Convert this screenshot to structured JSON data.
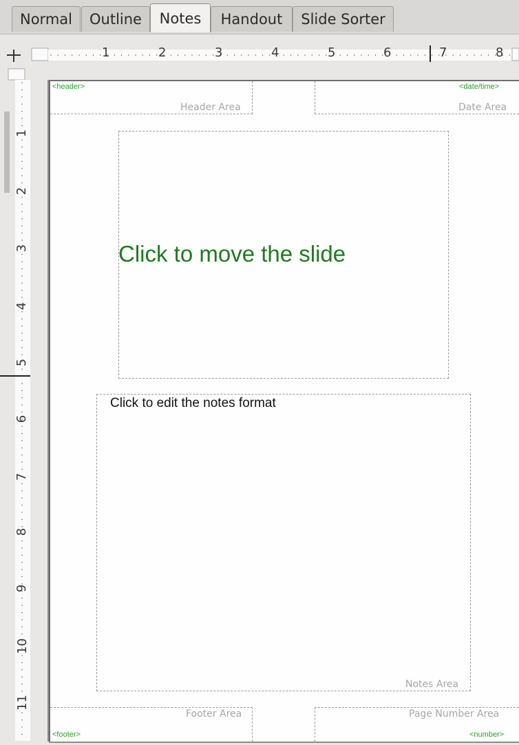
{
  "tabs": [
    {
      "label": "Normal",
      "active": false
    },
    {
      "label": "Outline",
      "active": false
    },
    {
      "label": "Notes",
      "active": true
    },
    {
      "label": "Handout",
      "active": false
    },
    {
      "label": "Slide Sorter",
      "active": false
    }
  ],
  "rulers": {
    "horizontal_labels": [
      "1",
      "2",
      "3",
      "4",
      "5",
      "6",
      "7",
      "8"
    ],
    "vertical_labels": [
      "1",
      "2",
      "3",
      "4",
      "5",
      "6",
      "7",
      "8",
      "9",
      "10",
      "11"
    ]
  },
  "page": {
    "header_field": "<header>",
    "header_area": "Header Area",
    "date_field": "<date/time>",
    "date_area": "Date Area",
    "slide_placeholder": "Click to move the slide",
    "notes_placeholder": "Click to edit the notes format",
    "notes_area": "Notes Area",
    "footer_area": "Footer Area",
    "footer_field": "<footer>",
    "page_number_area": "Page Number Area",
    "number_field": "<number>"
  },
  "colors": {
    "field_green": "#2aa12a",
    "slide_text_green": "#1f7a1f"
  }
}
